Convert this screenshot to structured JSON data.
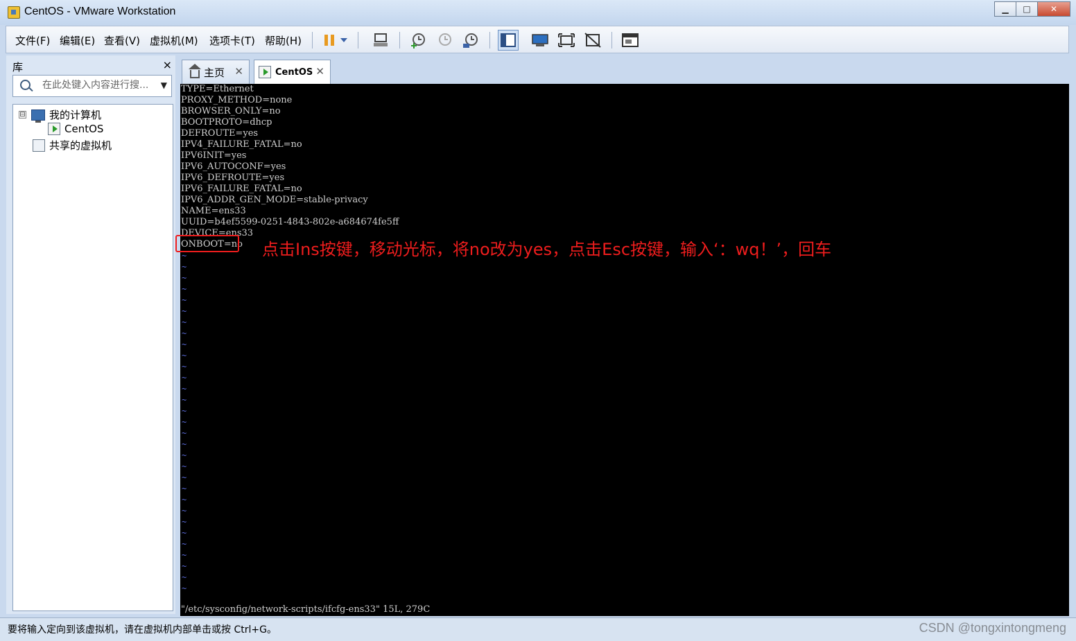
{
  "window": {
    "title": "CentOS - VMware Workstation",
    "minimize_label": "▁",
    "maximize_label": "□",
    "close_label": "✕"
  },
  "menu": {
    "items": [
      {
        "label": "文件(F)"
      },
      {
        "label": "编辑(E)"
      },
      {
        "label": "查看(V)"
      },
      {
        "label": "虚拟机(M)"
      },
      {
        "label": "选项卡(T)"
      },
      {
        "label": "帮助(H)"
      }
    ]
  },
  "toolbar": {
    "icons": [
      "pause-icon",
      "dropdown-arrow-icon",
      "send-ctrl-alt-del-icon",
      "snapshot-icon",
      "revert-snapshot-icon",
      "snapshot-manager-icon",
      "library-view-icon",
      "console-view-icon",
      "fullscreen-icon",
      "unity-icon",
      "tabs-view-icon"
    ]
  },
  "sidebar": {
    "title": "库",
    "close_label": "×",
    "search_placeholder": "在此处键入内容进行搜...",
    "tree": {
      "root_label": "我的计算机",
      "expander": "⊟",
      "vm_label": "CentOS",
      "shared_label": "共享的虚拟机"
    }
  },
  "tabs": [
    {
      "label": "主页",
      "close": "✕"
    },
    {
      "label": "CentOS",
      "close": "✕"
    }
  ],
  "terminal": {
    "lines": [
      "TYPE=Ethernet",
      "PROXY_METHOD=none",
      "BROWSER_ONLY=no",
      "BOOTPROTO=dhcp",
      "DEFROUTE=yes",
      "IPV4_FAILURE_FATAL=no",
      "IPV6INIT=yes",
      "IPV6_AUTOCONF=yes",
      "IPV6_DEFROUTE=yes",
      "IPV6_FAILURE_FATAL=no",
      "IPV6_ADDR_GEN_MODE=stable-privacy",
      "NAME=ens33",
      "UUID=b4ef5599-0251-4843-802e-a684674fe5ff",
      "DEVICE=ens33",
      "ONBOOT=no"
    ],
    "tilde": "~",
    "tilde_count": 31,
    "status_line": "\"/etc/sysconfig/network-scripts/ifcfg-ens33\" 15L, 279C"
  },
  "annotation": {
    "text": "点击Ins按键，移动光标，将no改为yes，点击Esc按键，输入‘：wq！’，回车",
    "color": "#ee1d1d"
  },
  "statusbar": {
    "text": "要将输入定向到该虚拟机，请在虚拟机内部单击或按 Ctrl+G。",
    "watermark": "CSDN @tongxintongmeng"
  },
  "colors": {
    "accent": "#c9d9ee",
    "annotation": "#ee1d1d",
    "tilde": "#5a6ad8"
  }
}
